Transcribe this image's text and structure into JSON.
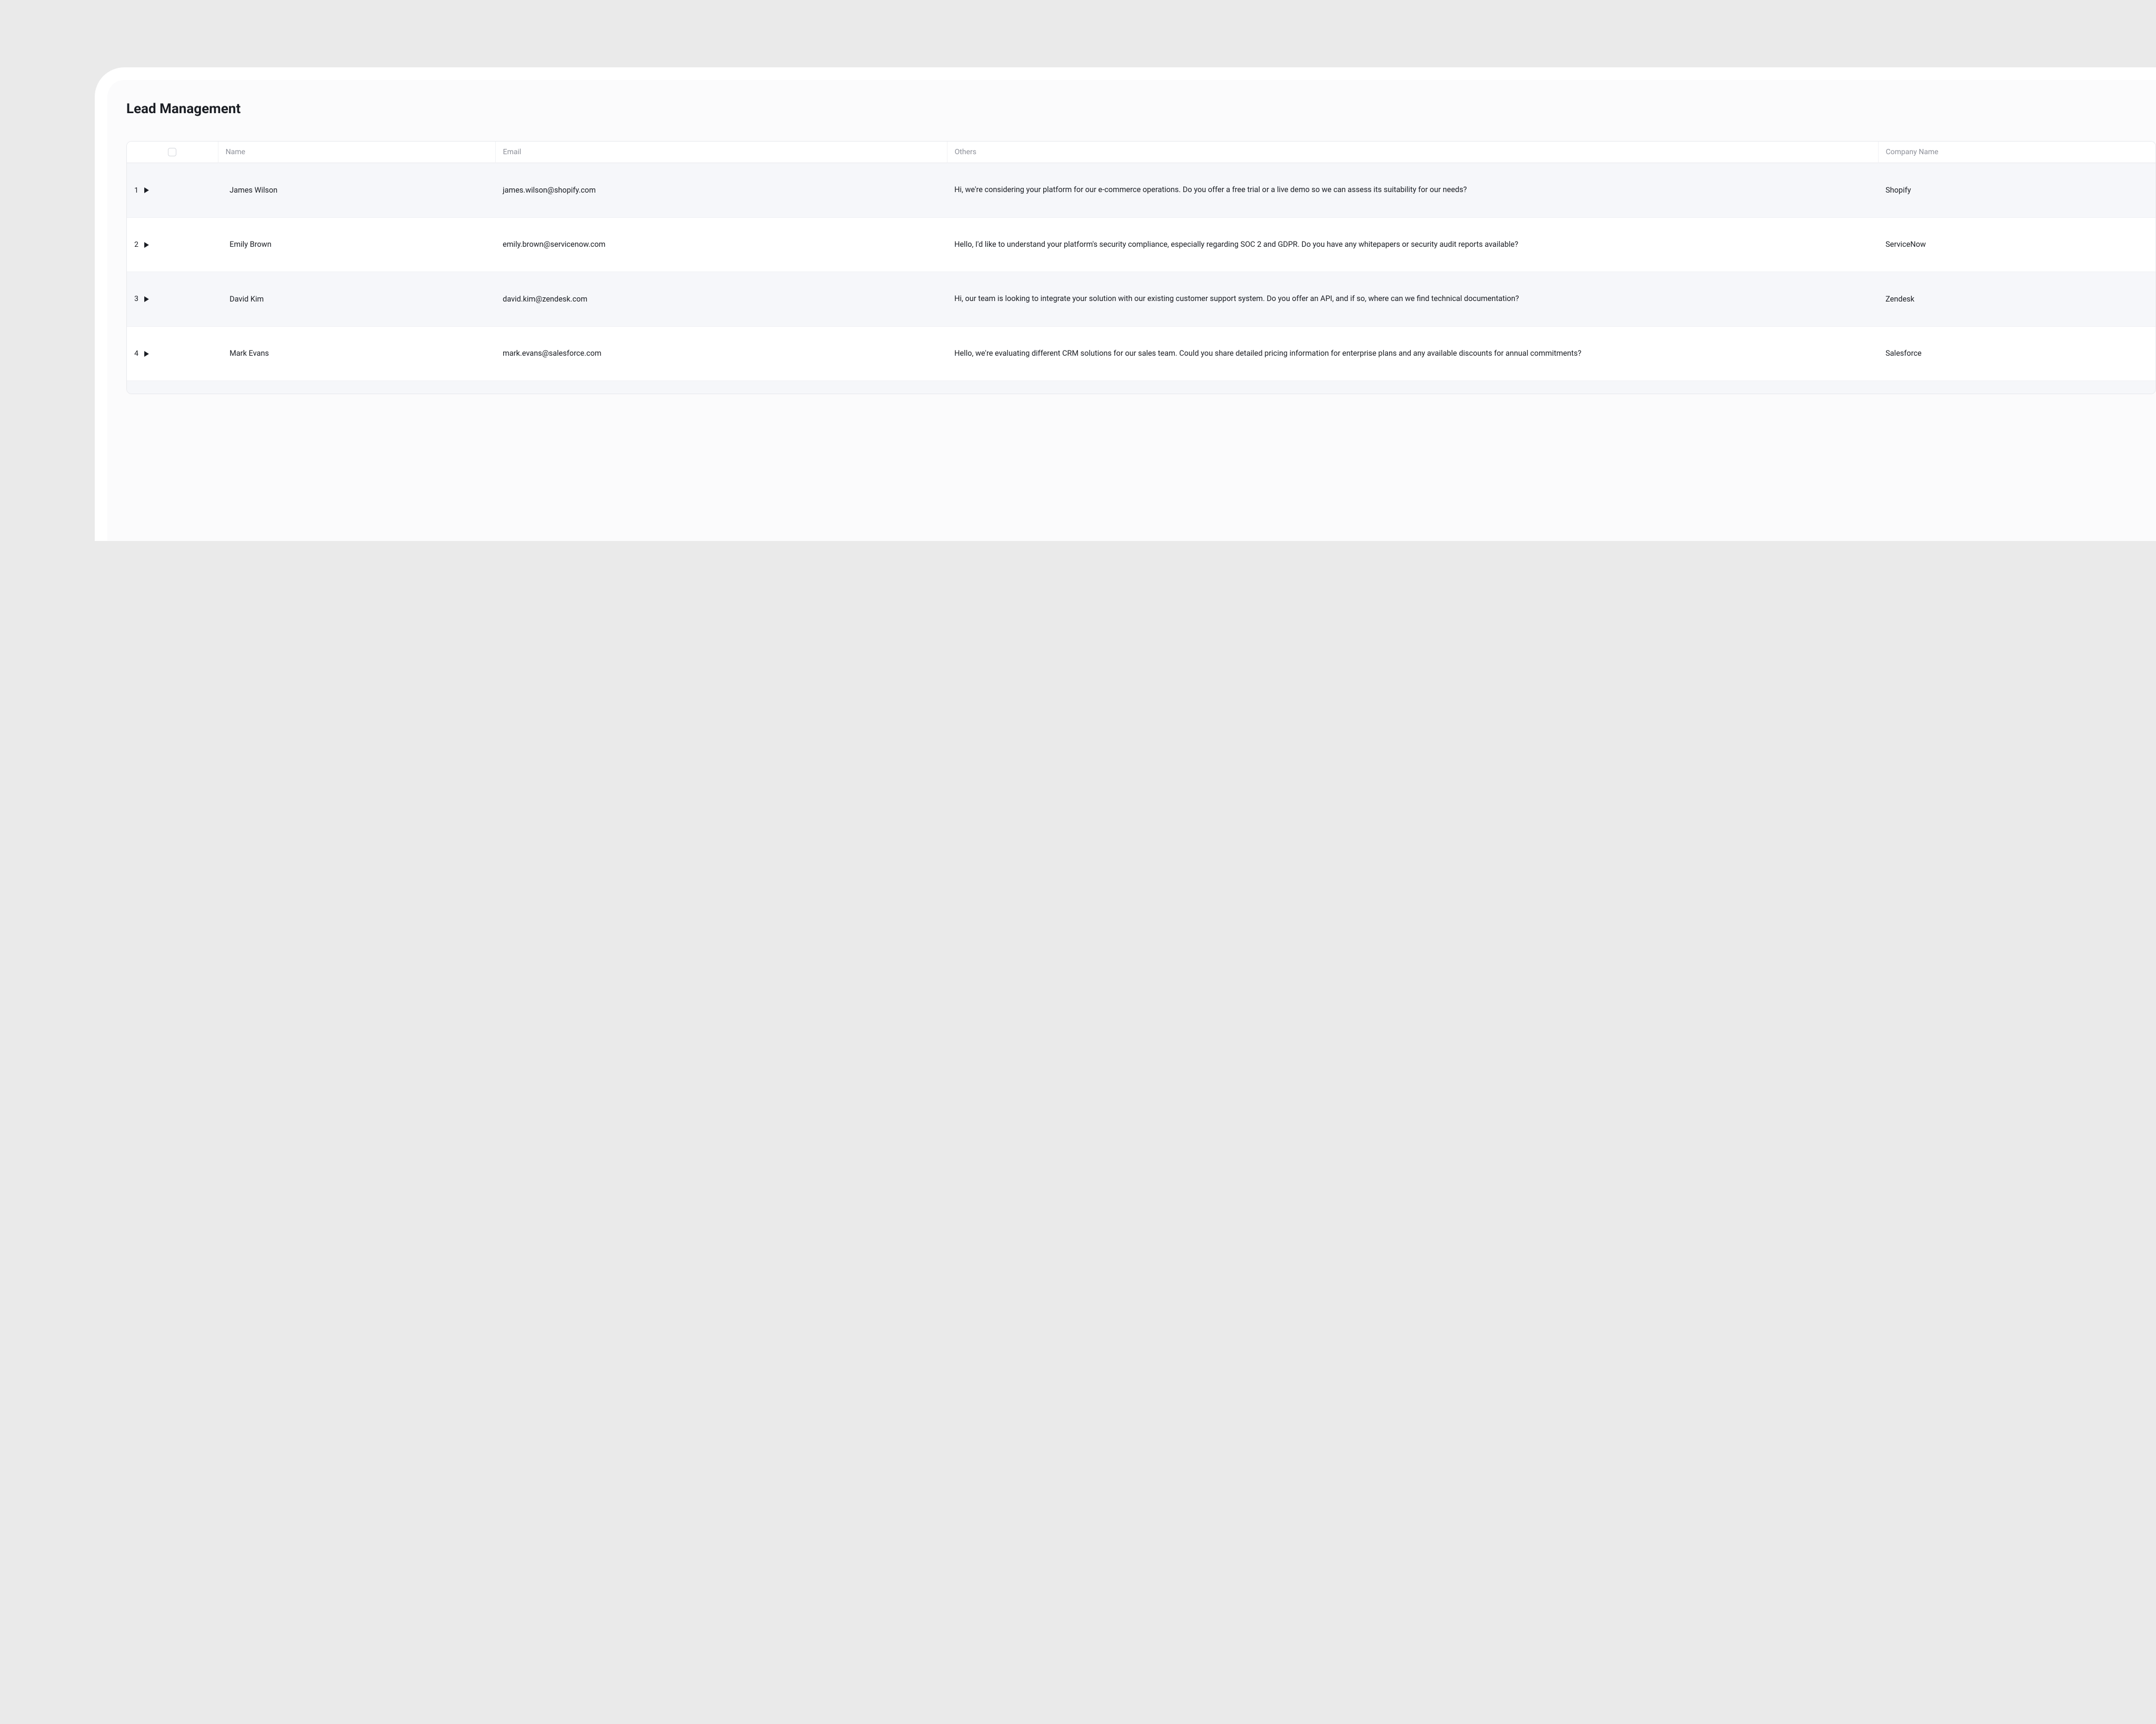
{
  "page": {
    "title": "Lead Management"
  },
  "table": {
    "columns": {
      "name": "Name",
      "email": "Email",
      "others": "Others",
      "company": "Company Name"
    },
    "rows": [
      {
        "index": "1",
        "name": "James Wilson",
        "email": "james.wilson@shopify.com",
        "others": "Hi, we're considering your platform for our e-commerce operations. Do you offer a free trial or a live demo so we can assess its suitability for our needs?",
        "company": "Shopify"
      },
      {
        "index": "2",
        "name": "Emily Brown",
        "email": "emily.brown@servicenow.com",
        "others": "Hello, I'd like to understand your platform's security compliance, especially regarding SOC 2 and GDPR. Do you have any whitepapers or security audit reports available?",
        "company": "ServiceNow"
      },
      {
        "index": "3",
        "name": "David Kim",
        "email": "david.kim@zendesk.com",
        "others": "Hi, our team is looking to integrate your solution with our existing customer support system. Do you offer an API, and if so, where can we find technical documentation?",
        "company": "Zendesk"
      },
      {
        "index": "4",
        "name": "Mark Evans",
        "email": "mark.evans@salesforce.com",
        "others": "Hello, we're evaluating different CRM solutions for our sales team. Could you share detailed pricing information for enterprise plans and any available discounts for annual commitments?",
        "company": "Salesforce"
      }
    ]
  }
}
